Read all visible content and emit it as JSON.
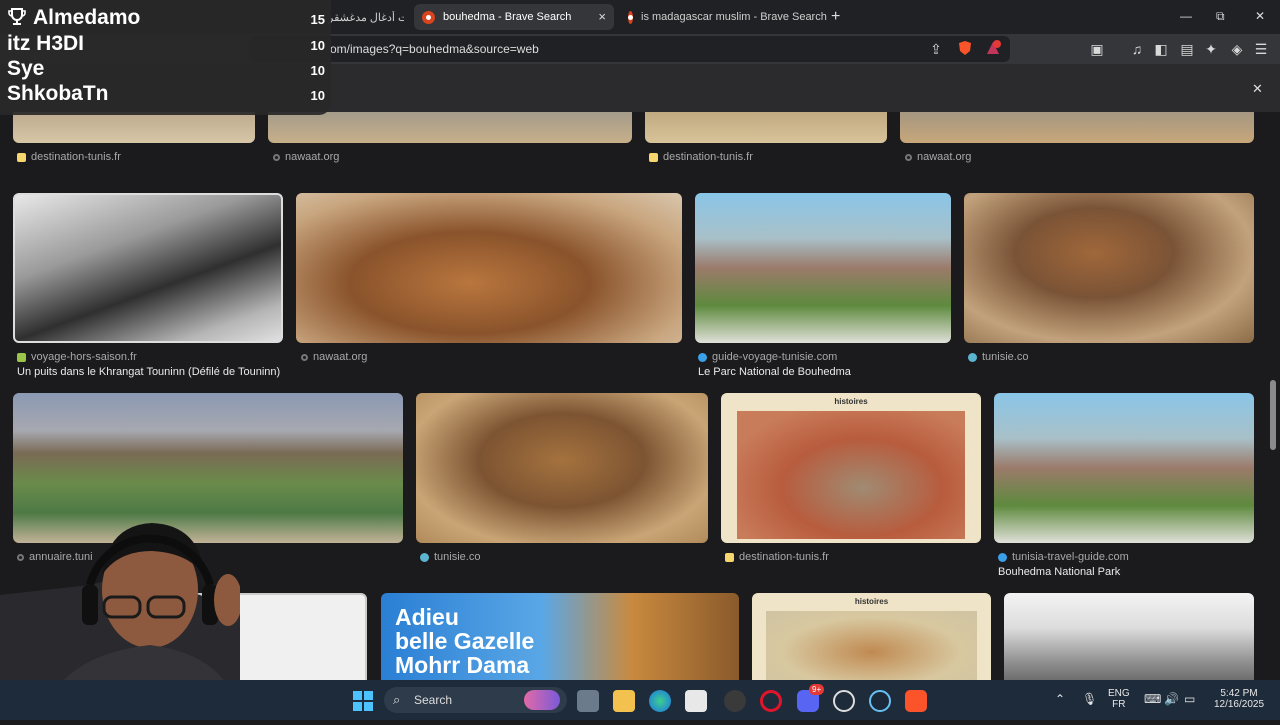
{
  "tabs": [
    {
      "label": "دجلت أدغال مدغشقر",
      "close": "×"
    },
    {
      "label": "bouhedma - Brave Search",
      "close": "×"
    },
    {
      "label": "is madagascar muslim - Brave Search",
      "close": "×"
    }
  ],
  "new_tab": "+",
  "window": {
    "minimize": "—",
    "restore": "⧉",
    "close": "✕"
  },
  "url": "om/images?q=bouhedma&source=web",
  "notif_close": "✕",
  "leaderboard": [
    {
      "name": "Almedamo",
      "score": "15"
    },
    {
      "name": "itz H3DI",
      "score": "10"
    },
    {
      "name": "Sye",
      "score": "10"
    },
    {
      "name": "ShkobaTn",
      "score": "10"
    }
  ],
  "results": {
    "row0": [
      {
        "source": "destination-tunis.fr"
      },
      {
        "source": "nawaat.org"
      },
      {
        "source": "destination-tunis.fr"
      },
      {
        "source": "nawaat.org"
      }
    ],
    "row1": [
      {
        "source": "voyage-hors-saison.fr",
        "caption": "Un puits dans le Khrangat Touninn (Défilé de Touninn)"
      },
      {
        "source": "nawaat.org",
        "caption": ""
      },
      {
        "source": "guide-voyage-tunisie.com",
        "caption": "Le Parc National de Bouhedma"
      },
      {
        "source": "tunisie.co",
        "caption": ""
      }
    ],
    "row2": [
      {
        "source": "annuaire.tuni",
        "caption": ""
      },
      {
        "source": "tunisie.co",
        "caption": ""
      },
      {
        "source": "destination-tunis.fr",
        "caption": ""
      },
      {
        "source": "tunisia-travel-guide.com",
        "caption": "Bouhedma National Park"
      }
    ],
    "row3_text": [
      "Adieu",
      "belle Gazelle",
      "Mohrr Dama"
    ],
    "histoires": "histoires"
  },
  "taskbar": {
    "search_label": "Search",
    "lang": "ENG",
    "region": "FR",
    "time": "5:42 PM",
    "date": "12/16/2025",
    "discord_badge": "9+"
  },
  "colors": {
    "brave": "#fb542b",
    "tab_active": "#35363a",
    "taskbar": "#1e2b3a"
  }
}
